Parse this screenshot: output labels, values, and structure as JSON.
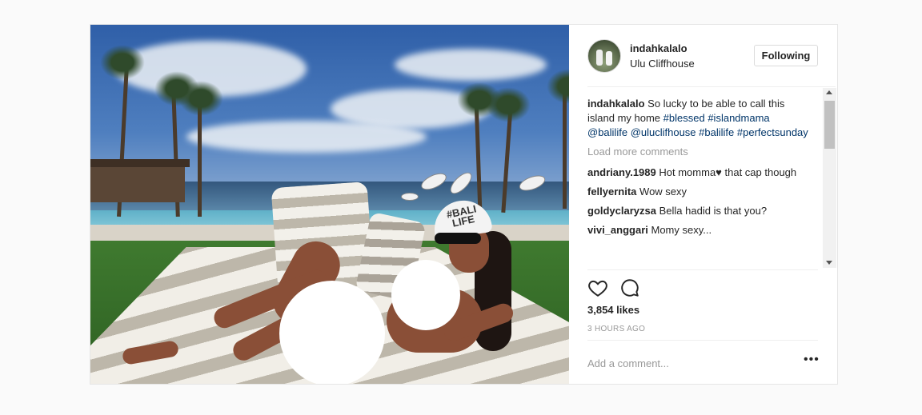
{
  "post": {
    "username": "indahkalalo",
    "location": "Ulu Cliffhouse",
    "follow_label": "Following",
    "photo_text": "#BALI\nLIFE",
    "caption": {
      "user": "indahkalalo",
      "text": "So lucky to be able to call this island my home ",
      "tags": [
        "#blessed",
        "#islandmama",
        "@balilife",
        "@uluclifhouse",
        "#balilife",
        "#perfectsunday"
      ]
    },
    "load_more": "Load more comments",
    "comments": [
      {
        "user": "andriany.1989",
        "text": "Hot momma♥ that cap though"
      },
      {
        "user": "fellyernita",
        "text": "Wow sexy"
      },
      {
        "user": "goldyclaryzsa",
        "text": "Bella hadid is that you?"
      },
      {
        "user": "vivi_anggari",
        "text": "Momy sexy..."
      }
    ],
    "likes": "3,854 likes",
    "time": "3 HOURS AGO",
    "add_comment_placeholder": "Add a comment...",
    "more_label": "•••",
    "icons": [
      "heart-icon",
      "comment-icon",
      "more-options-icon"
    ]
  }
}
